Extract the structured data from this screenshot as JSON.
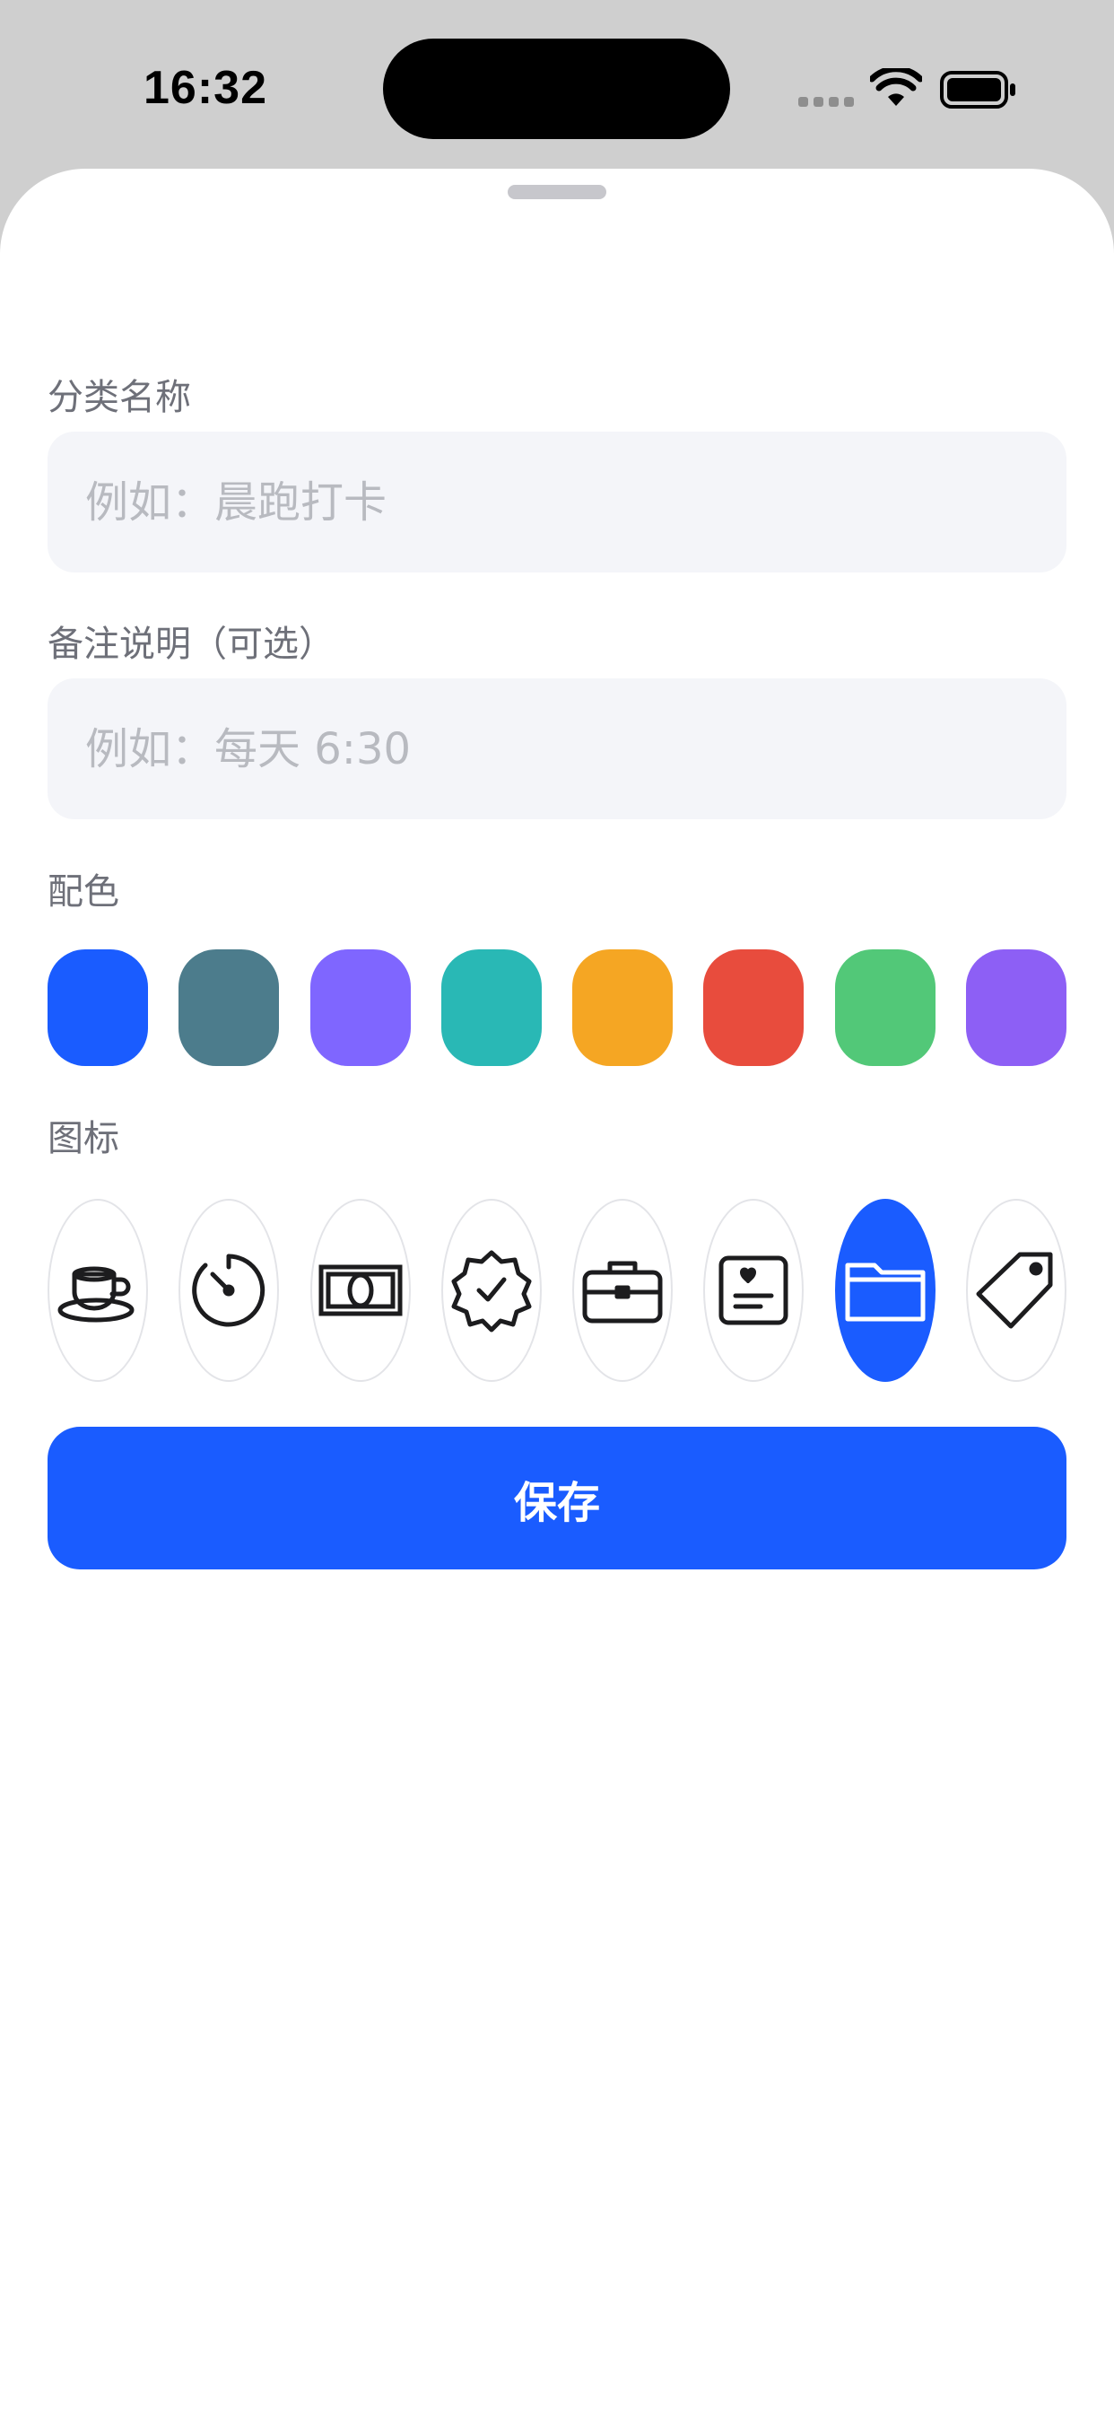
{
  "status_bar": {
    "time": "16:32"
  },
  "form": {
    "name_label": "分类名称",
    "name_placeholder": "例如：晨跑打卡",
    "note_label": "备注说明（可选）",
    "note_placeholder": "例如：每天 6:30",
    "color_label": "配色",
    "icon_label": "图标",
    "save_label": "保存"
  },
  "colors": [
    {
      "name": "blue",
      "hex": "#1a5cff",
      "selected": true
    },
    {
      "name": "slate-teal",
      "hex": "#4c7c8c",
      "selected": false
    },
    {
      "name": "violet",
      "hex": "#7f66ff",
      "selected": false
    },
    {
      "name": "teal",
      "hex": "#29b8b5",
      "selected": false
    },
    {
      "name": "orange",
      "hex": "#f5a623",
      "selected": false
    },
    {
      "name": "red",
      "hex": "#e84c3d",
      "selected": false
    },
    {
      "name": "green",
      "hex": "#52c878",
      "selected": false
    },
    {
      "name": "purple",
      "hex": "#8d5ff5",
      "selected": false
    }
  ],
  "icons": [
    {
      "name": "cup-icon",
      "selected": false
    },
    {
      "name": "timer-icon",
      "selected": false
    },
    {
      "name": "banknote-icon",
      "selected": false
    },
    {
      "name": "checkmark-seal-icon",
      "selected": false
    },
    {
      "name": "briefcase-icon",
      "selected": false
    },
    {
      "name": "heart-card-icon",
      "selected": false
    },
    {
      "name": "folder-icon",
      "selected": true
    },
    {
      "name": "tag-icon",
      "selected": false
    }
  ],
  "accent_color": "#1a5cff"
}
